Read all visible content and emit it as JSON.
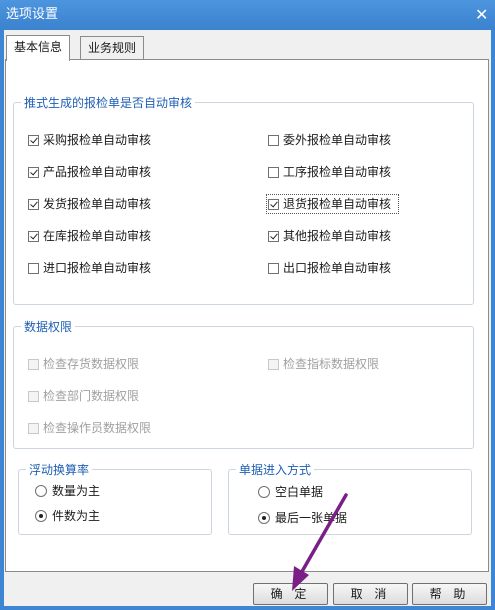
{
  "window": {
    "title": "选项设置",
    "close_glyph": "✕"
  },
  "tabs": [
    {
      "label": "基本信息"
    },
    {
      "label": "业务规则"
    }
  ],
  "auto_review": {
    "legend": "推式生成的报检单是否自动审核",
    "items": [
      {
        "label": "采购报检单自动审核",
        "checked": true
      },
      {
        "label": "委外报检单自动审核",
        "checked": false
      },
      {
        "label": "产品报检单自动审核",
        "checked": true
      },
      {
        "label": "工序报检单自动审核",
        "checked": false
      },
      {
        "label": "发货报检单自动审核",
        "checked": true
      },
      {
        "label": "退货报检单自动审核",
        "checked": true
      },
      {
        "label": "在库报检单自动审核",
        "checked": true
      },
      {
        "label": "其他报检单自动审核",
        "checked": true
      },
      {
        "label": "进口报检单自动审核",
        "checked": false
      },
      {
        "label": "出口报检单自动审核",
        "checked": false
      }
    ]
  },
  "data_permission": {
    "legend": "数据权限",
    "items": [
      {
        "label": "检查存货数据权限"
      },
      {
        "label": "检查指标数据权限"
      },
      {
        "label": "检查部门数据权限"
      },
      {
        "label": "检查操作员数据权限"
      }
    ]
  },
  "float_rate": {
    "legend": "浮动换算率",
    "options": [
      {
        "label": "数量为主",
        "selected": false
      },
      {
        "label": "件数为主",
        "selected": true
      }
    ]
  },
  "entry_mode": {
    "legend": "单据进入方式",
    "options": [
      {
        "label": "空白单据",
        "selected": false
      },
      {
        "label": "最后一张单据",
        "selected": true
      }
    ]
  },
  "buttons": {
    "ok": "确 定",
    "cancel": "取 消",
    "help": "帮 助"
  },
  "colors": {
    "title_bar": "#3b82cf",
    "legend": "#1f5fb3",
    "arrow": "#7a1f86"
  }
}
